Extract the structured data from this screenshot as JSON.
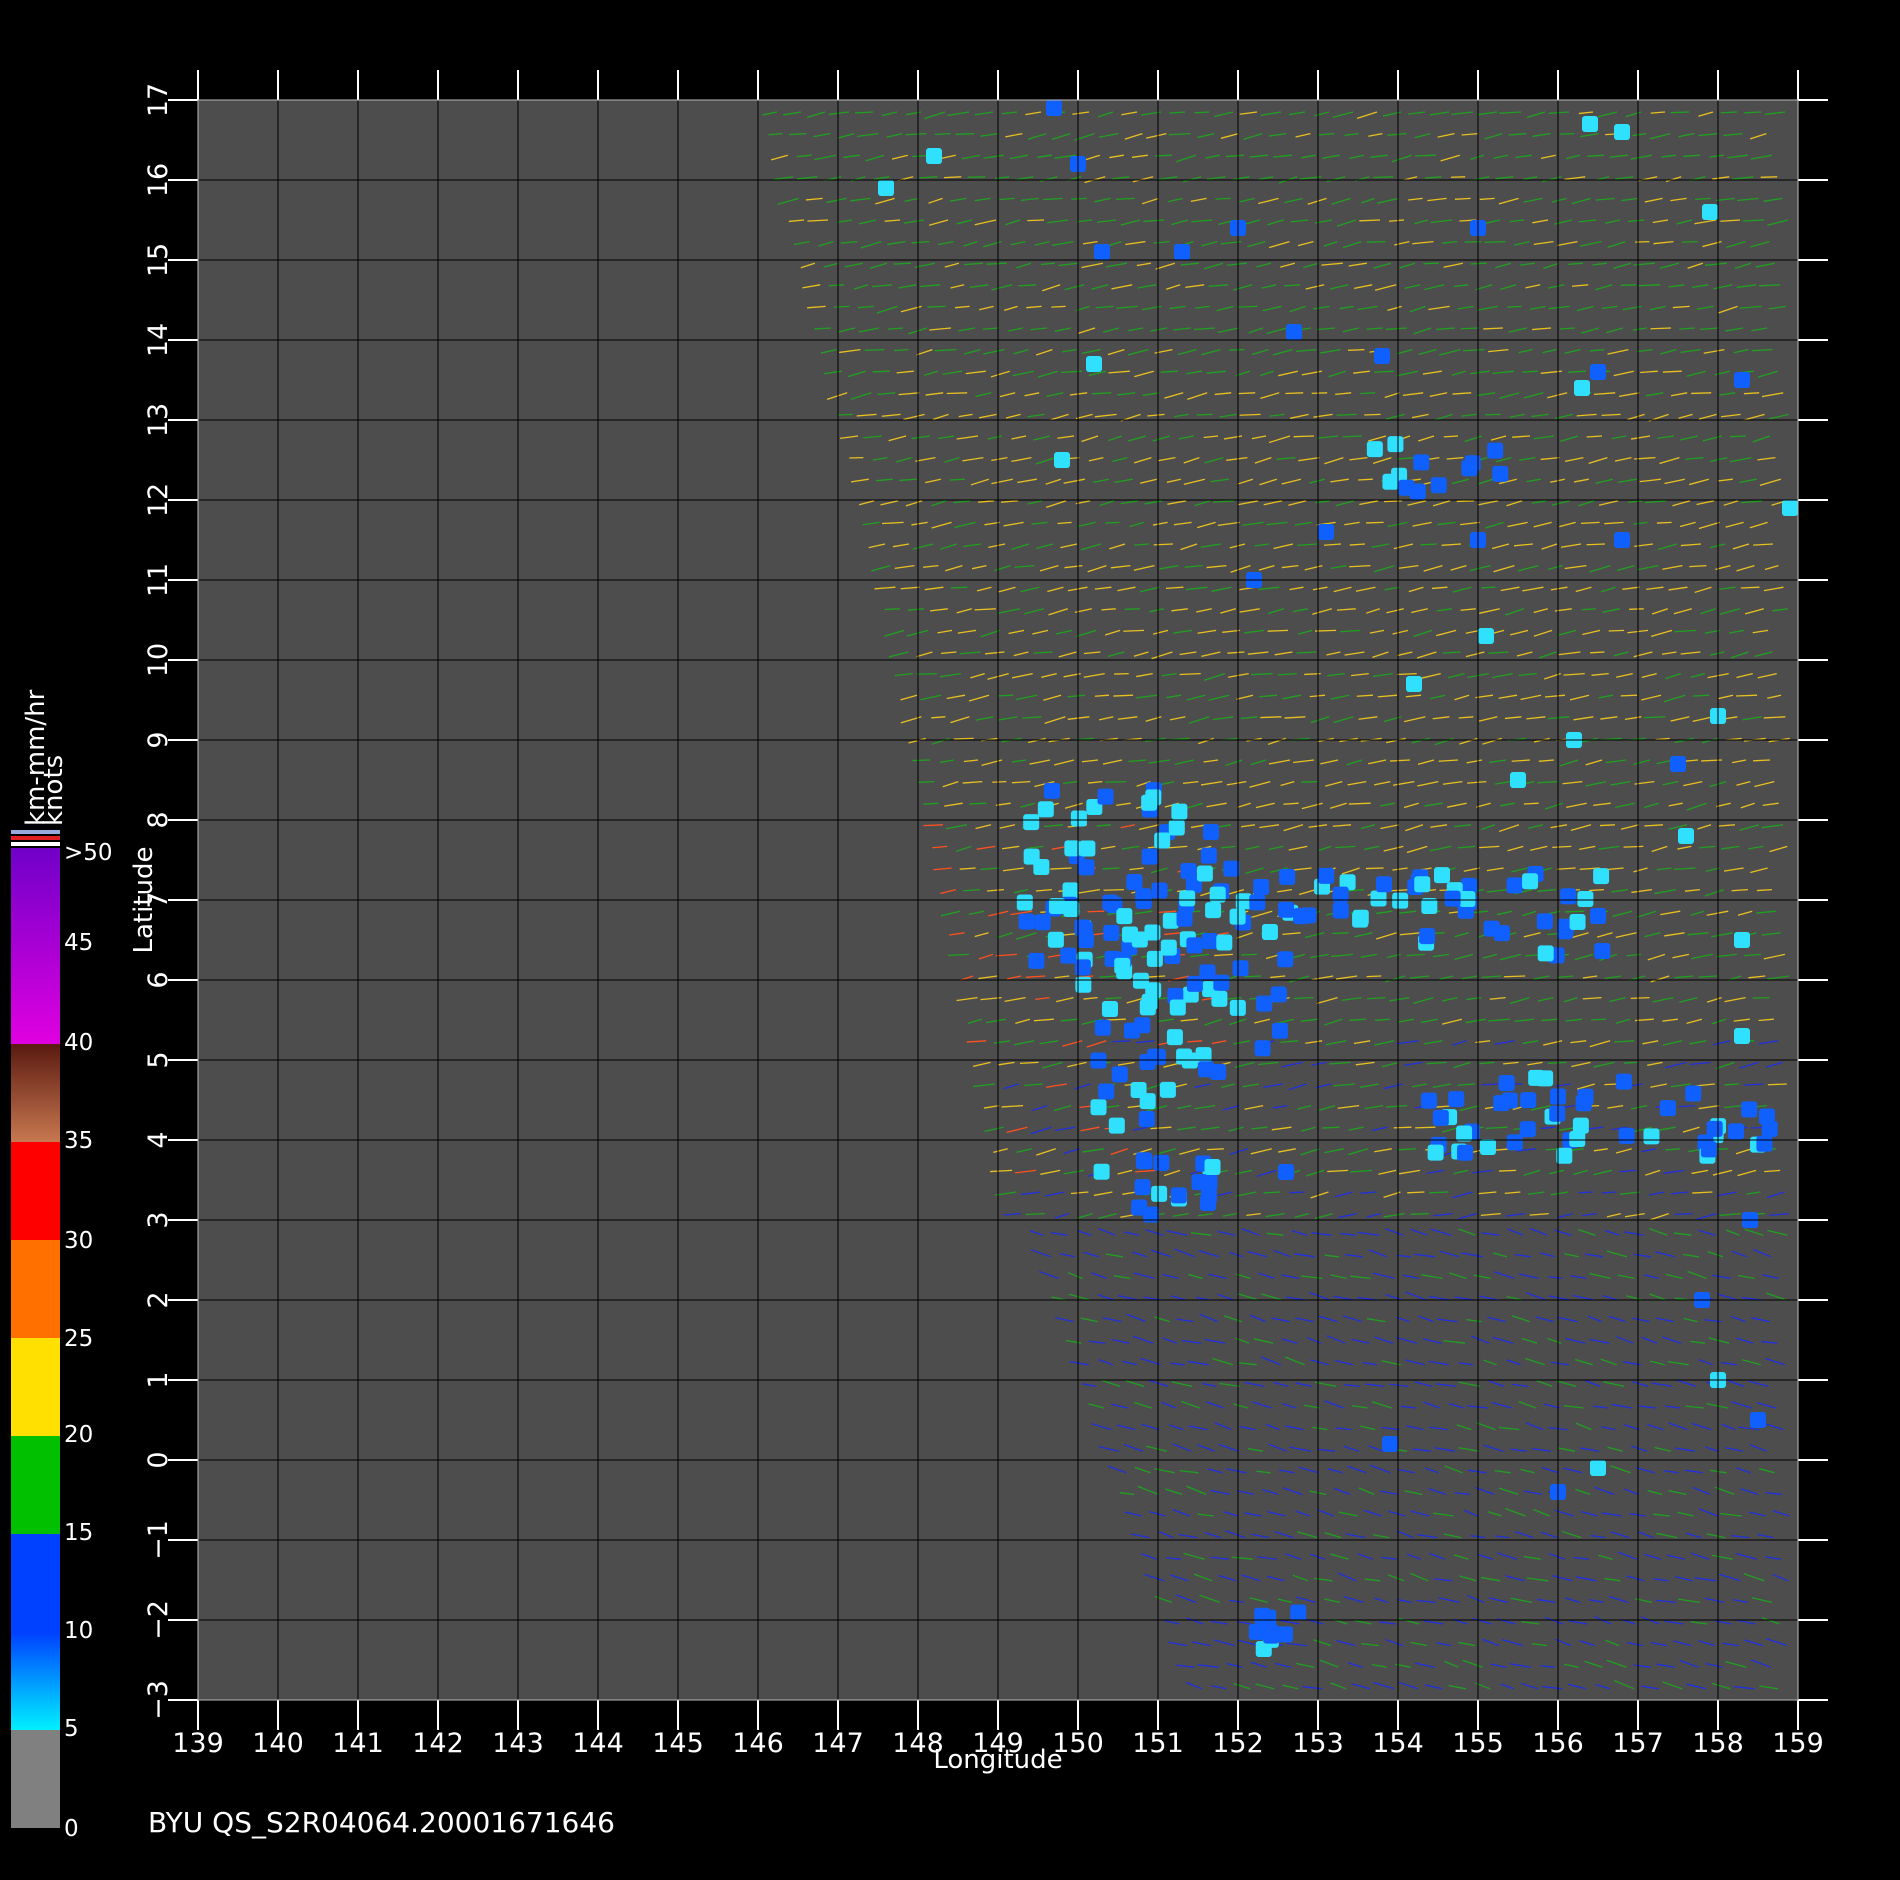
{
  "footer": {
    "caption": "BYU QS_S2R04064.20001671646"
  },
  "axes": {
    "x_label": "Longitude",
    "y_label": "Latitude",
    "x_range": [
      139,
      159
    ],
    "y_range": [
      -3,
      17
    ],
    "x_ticks": [
      "139",
      "140",
      "141",
      "142",
      "143",
      "144",
      "145",
      "146",
      "147",
      "148",
      "149",
      "150",
      "151",
      "152",
      "153",
      "154",
      "155",
      "156",
      "157",
      "158",
      "159"
    ],
    "y_ticks": [
      "17",
      "16",
      "15",
      "14",
      "13",
      "12",
      "11",
      "10",
      "9",
      "8",
      "7",
      "6",
      "5",
      "4",
      "3",
      "2",
      "1",
      "0",
      "−1",
      "−2",
      "−3"
    ]
  },
  "colorbar": {
    "unit_top": "km-mm/hr",
    "unit_bottom": "knots",
    "labels": [
      ">50",
      "45",
      "40",
      "35",
      "30",
      "25",
      "20",
      "15",
      "10",
      "5",
      "0"
    ],
    "colors": {
      "over": "#7000c8",
      "magenta": "#e000e0",
      "brown": "#5a1a10",
      "tan": "#c87850",
      "red": "#ff0000",
      "orange": "#ff7000",
      "yellow": "#ffe000",
      "green": "#00c000",
      "blue": "#0040ff",
      "cyan": "#00f0ff",
      "gray": "#808080"
    }
  },
  "map": {
    "background": "#4d4d4d",
    "rain_colors": {
      "heavy": "#1060ff",
      "light": "#30e0ff"
    },
    "vector_colors": {
      "weak": "#2030e0",
      "moderate": "#20a020",
      "strong": "#e8c020",
      "gust": "#ff5020",
      "flag": "#ffffff"
    }
  }
}
